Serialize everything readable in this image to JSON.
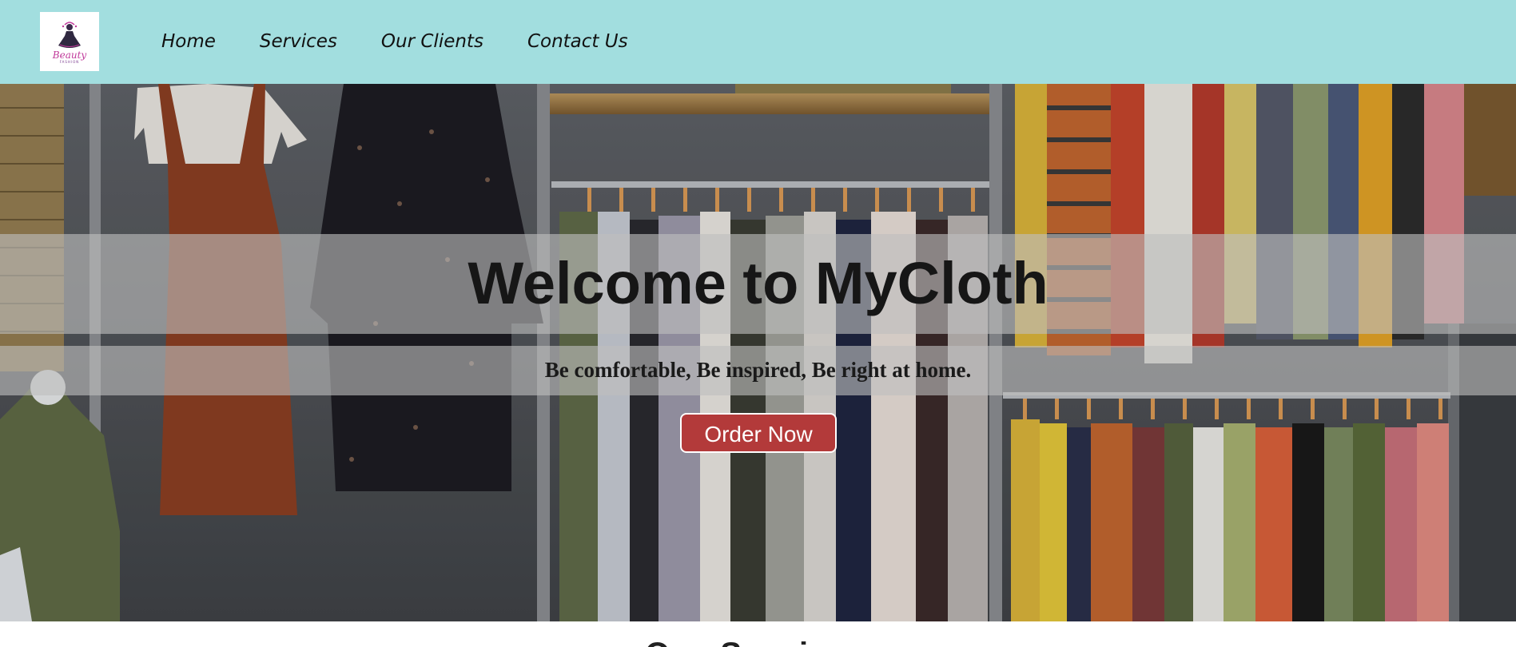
{
  "brand": {
    "logo_name": "Beauty",
    "logo_tagline": "FASHION",
    "logo_color": "#c0399a"
  },
  "nav": {
    "items": [
      {
        "label": "Home"
      },
      {
        "label": "Services"
      },
      {
        "label": "Our Clients"
      },
      {
        "label": "Contact Us"
      }
    ],
    "background": "#a2dedf"
  },
  "hero": {
    "title": "Welcome to MyCloth",
    "subtitle": "Be comfortable, Be inspired, Be right at home.",
    "cta_label": "Order Now",
    "cta_color": "#b33a3a"
  },
  "next_section": {
    "heading": "Our Services"
  }
}
